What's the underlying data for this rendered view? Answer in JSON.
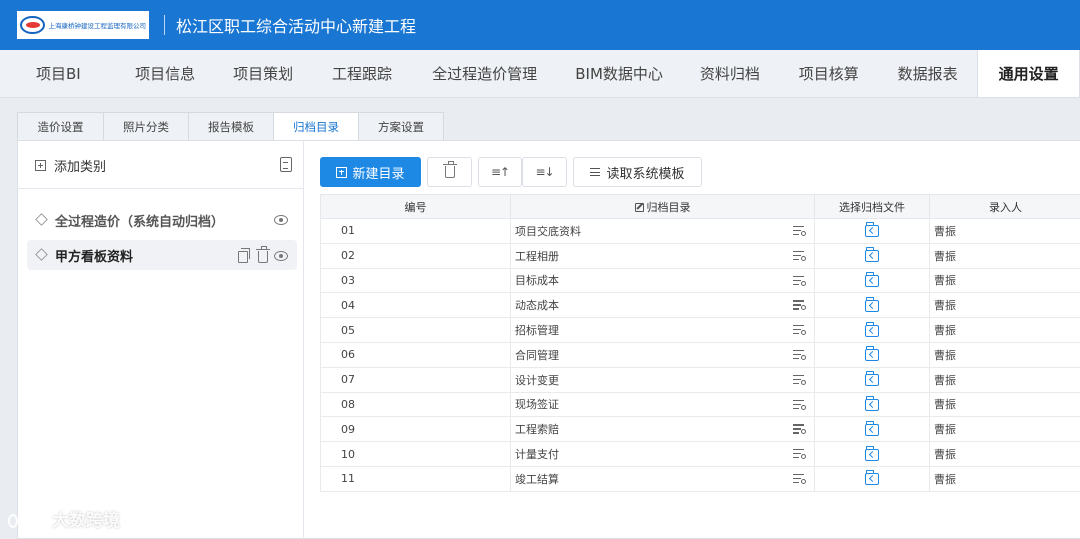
{
  "header": {
    "logo_text": "上海康桥钟建设工程监理有限公司",
    "project_title": "松江区职工综合活动中心新建工程"
  },
  "main_nav": [
    {
      "label": "项目BI"
    },
    {
      "label": "项目信息"
    },
    {
      "label": "项目策划"
    },
    {
      "label": "工程跟踪"
    },
    {
      "label": "全过程造价管理"
    },
    {
      "label": "BIM数据中心"
    },
    {
      "label": "资料归档"
    },
    {
      "label": "项目核算"
    },
    {
      "label": "数据报表"
    },
    {
      "label": "通用设置",
      "active": true
    }
  ],
  "sub_tabs": [
    {
      "label": "造价设置"
    },
    {
      "label": "照片分类"
    },
    {
      "label": "报告模板"
    },
    {
      "label": "归档目录",
      "active": true
    },
    {
      "label": "方案设置"
    }
  ],
  "sidebar": {
    "add_category_label": "添加类别",
    "categories": [
      {
        "label": "全过程造价（系统自动归档）",
        "selected": false
      },
      {
        "label": "甲方看板资料",
        "selected": true
      }
    ]
  },
  "toolbar": {
    "new_dir_label": "新建目录",
    "read_template_label": "读取系统模板"
  },
  "table": {
    "headers": {
      "code": "编号",
      "dir": "归档目录",
      "file": "选择归档文件",
      "entrant": "录入人"
    },
    "rows": [
      {
        "code": "01",
        "name": "项目交底资料",
        "entrant": "曹振"
      },
      {
        "code": "02",
        "name": "工程相册",
        "entrant": "曹振"
      },
      {
        "code": "03",
        "name": "目标成本",
        "entrant": "曹振"
      },
      {
        "code": "04",
        "name": "动态成本",
        "entrant": "曹振"
      },
      {
        "code": "05",
        "name": "招标管理",
        "entrant": "曹振"
      },
      {
        "code": "06",
        "name": "合同管理",
        "entrant": "曹振"
      },
      {
        "code": "07",
        "name": "设计变更",
        "entrant": "曹振"
      },
      {
        "code": "08",
        "name": "现场签证",
        "entrant": "曹振"
      },
      {
        "code": "09",
        "name": "工程索赔",
        "entrant": "曹振"
      },
      {
        "code": "10",
        "name": "计量支付",
        "entrant": "曹振"
      },
      {
        "code": "11",
        "name": "竣工结算",
        "entrant": "曹振"
      }
    ]
  },
  "watermark": {
    "text": "大数跨境"
  },
  "colors": {
    "header_bg": "#1976d2",
    "primary": "#1e88e5",
    "active_subtab": "#1976d2"
  }
}
